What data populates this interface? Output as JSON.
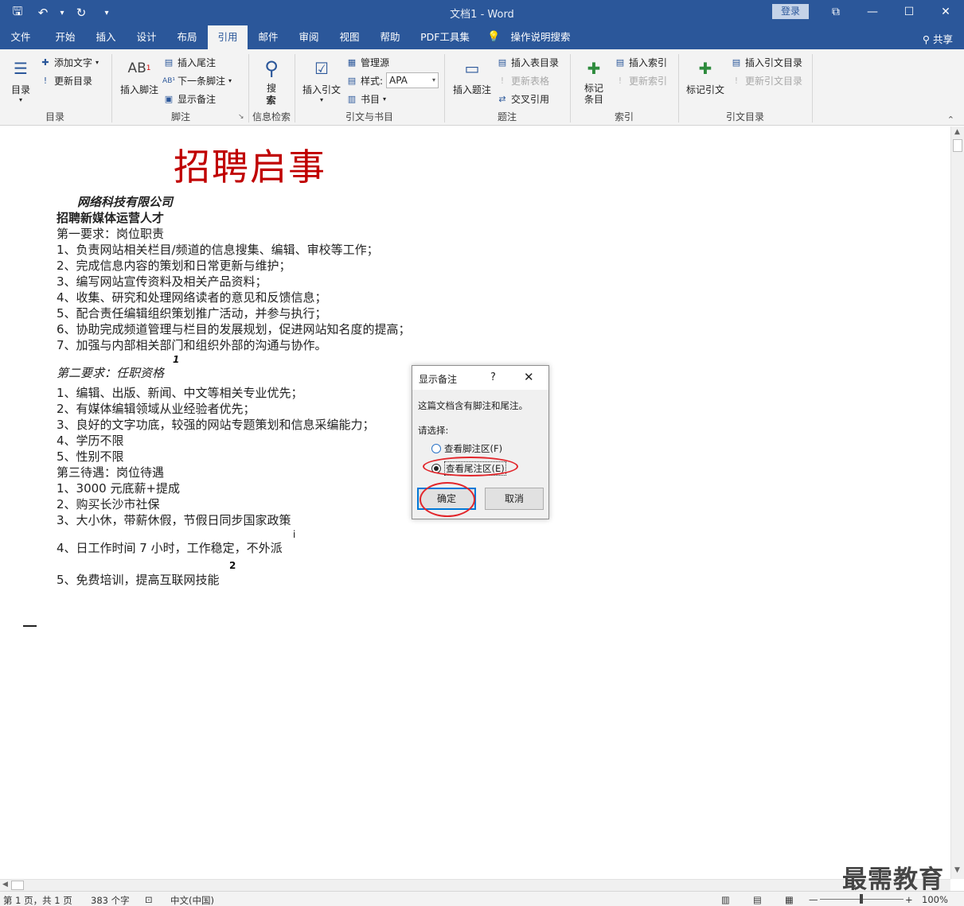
{
  "titlebar": {
    "title": "文档1  -  Word",
    "login": "登录",
    "qat": {
      "save": "🖫",
      "undo": "↶",
      "undo_dd": "▾",
      "redo": "↻",
      "customize": "▾"
    },
    "controls": {
      "ribbon_display": "⧉",
      "minimize": "—",
      "restore": "☐",
      "close": "✕"
    }
  },
  "tabs": [
    {
      "label": "文件"
    },
    {
      "label": "开始"
    },
    {
      "label": "插入"
    },
    {
      "label": "设计"
    },
    {
      "label": "布局"
    },
    {
      "label": "引用"
    },
    {
      "label": "邮件"
    },
    {
      "label": "审阅"
    },
    {
      "label": "视图"
    },
    {
      "label": "帮助"
    },
    {
      "label": "PDF工具集"
    },
    {
      "label": "操作说明搜索"
    }
  ],
  "share": "共享",
  "ribbon": {
    "toc": {
      "big": "目录",
      "add_text": "添加文字",
      "update_toc": "更新目录",
      "group": "目录"
    },
    "footnotes": {
      "insert_footnote": "插入脚注",
      "insert_endnote": "插入尾注",
      "next_footnote": "下一条脚注",
      "show_notes": "显示备注",
      "group": "脚注",
      "ab_glyph": "AB"
    },
    "research": {
      "search": "搜索",
      "search_line2": "索",
      "group": "信息检索"
    },
    "citations": {
      "insert_citation": "插入引文",
      "manage_sources": "管理源",
      "style_label": "样式:",
      "style_value": "APA",
      "bibliography": "书目",
      "group": "引文与书目"
    },
    "captions": {
      "insert_caption": "插入题注",
      "insert_table_figures": "插入表目录",
      "update_table": "更新表格",
      "cross_reference": "交叉引用",
      "group": "题注"
    },
    "index": {
      "mark_entry": "标记条目",
      "insert_index": "插入索引",
      "update_index": "更新索引",
      "group": "索引"
    },
    "toa": {
      "mark_citation": "标记引文",
      "insert_toa": "插入引文目录",
      "update_toa": "更新引文目录",
      "group": "引文目录"
    }
  },
  "document": {
    "title": "招聘启事",
    "company": "网络科技有限公司",
    "position": "招聘新媒体运营人才",
    "req1_head": "第一要求：岗位职责",
    "req1": [
      "1、负责网站相关栏目/频道的信息搜集、编辑、审校等工作；",
      "2、完成信息内容的策划和日常更新与维护；",
      "3、编写网站宣传资料及相关产品资料；",
      "4、收集、研究和处理网络读者的意见和反馈信息；",
      "5、配合责任编辑组织策划推广活动，并参与执行；",
      "6、协助完成频道管理与栏目的发展规划，促进网站知名度的提高；",
      "7、加强与内部相关部门和组织外部的沟通与协作。"
    ],
    "sup_1": "1",
    "req2_head": "第二要求：任职资格",
    "req2": [
      "1、编辑、出版、新闻、中文等相关专业优先；",
      "2、有媒体编辑领域从业经验者优先；",
      "3、良好的文字功底，较强的网站专题策划和信息采编能力；",
      "4、学历不限",
      "5、性别不限"
    ],
    "req3_head": "第三待遇：岗位待遇",
    "req3": [
      "1、3000 元底薪+提成",
      "2、购买长沙市社保",
      "3、大小休，带薪休假，节假日同步国家政策",
      "4、日工作时间 7 小时，工作稳定，不外派",
      "5、免费培训，提高互联网技能"
    ],
    "sup_i": "i",
    "sup_2": "2"
  },
  "dialog": {
    "title": "显示备注",
    "help": "?",
    "close": "✕",
    "message": "这篇文档含有脚注和尾注。",
    "choose": "请选择:",
    "option_footnote": "查看脚注区(F)",
    "option_endnote": "查看尾注区(E)",
    "selected": "endnote",
    "ok": "确定",
    "cancel": "取消",
    "highlight_color": "#e2262b"
  },
  "statusbar": {
    "page": "第 1 页，共 1 页",
    "words": "383 个字",
    "language": "中文(中国)",
    "zoom": "100%",
    "zoom_minus": "—",
    "zoom_plus": "+"
  },
  "watermark": "最需教育",
  "colors": {
    "accent": "#2b579a",
    "title_red": "#c00000",
    "annotation_red": "#e2262b"
  }
}
